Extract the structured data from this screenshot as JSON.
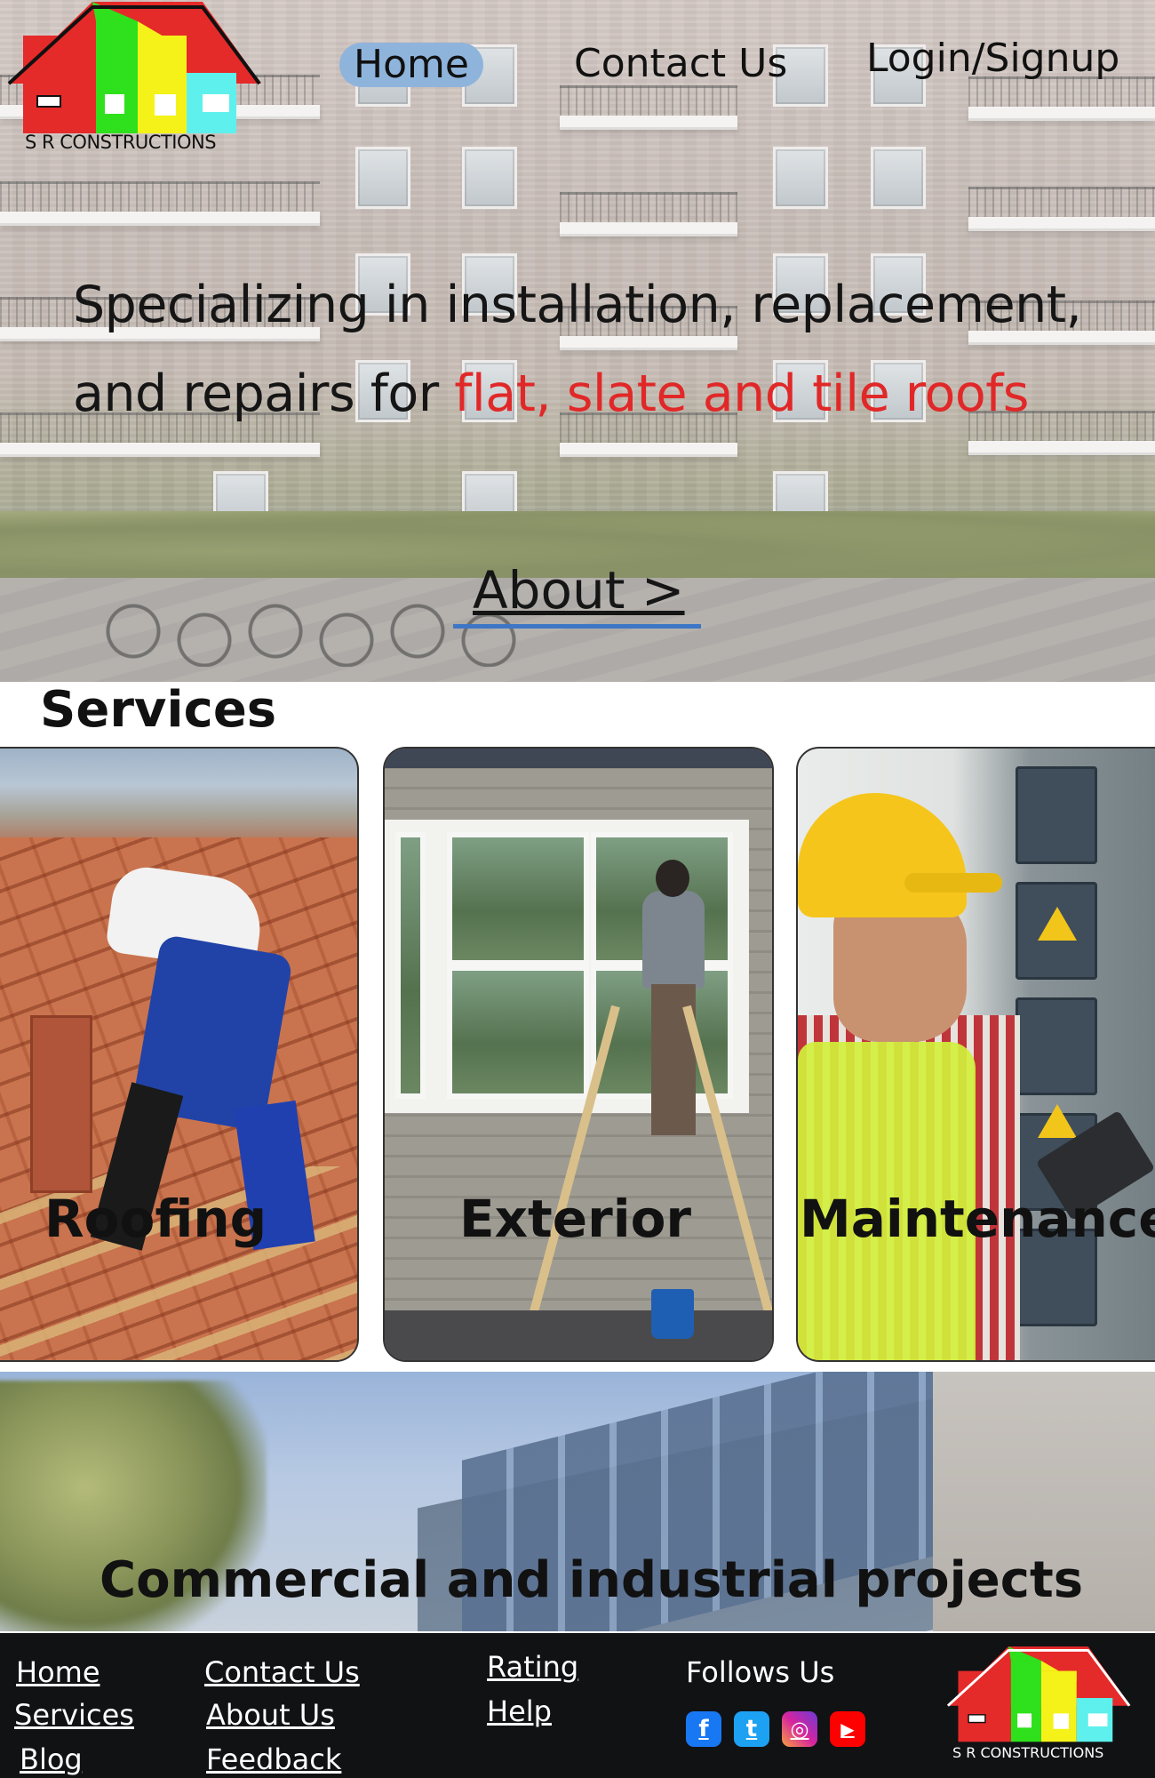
{
  "brand": {
    "name": "S R CONSTRUCTIONS",
    "colors": {
      "red": "#e52a2a",
      "green": "#2fe01c",
      "yellow": "#f5f21a",
      "cyan": "#5ef0ec"
    }
  },
  "nav": {
    "home": "Home",
    "contact": "Contact Us",
    "login": "Login/Signup",
    "active": "Home"
  },
  "hero": {
    "line1": "Specializing in installation, replacement,",
    "line2_prefix": "and repairs for ",
    "line2_highlight": "flat, slate and tile roofs",
    "about_link": "About >"
  },
  "services": {
    "title": "Services",
    "items": [
      {
        "label": "Roofing"
      },
      {
        "label": "Exterior"
      },
      {
        "label": "Maintenance"
      }
    ]
  },
  "projects": {
    "title": "Commercial and industrial projects"
  },
  "footer": {
    "col1": [
      "Home",
      "Services",
      "Blog"
    ],
    "col2": [
      "Contact Us",
      "About Us",
      "Feedback"
    ],
    "col3": [
      "Rating",
      "Help"
    ],
    "follow_title": "Follows Us",
    "social": [
      {
        "icon": "facebook-icon",
        "glyph": "f",
        "color": "#1877f2"
      },
      {
        "icon": "twitter-icon",
        "glyph": "t",
        "color": "#1da1f2"
      },
      {
        "icon": "instagram-icon",
        "glyph": "◎",
        "color": "#d6249f"
      },
      {
        "icon": "youtube-icon",
        "glyph": "▶",
        "color": "#ff0000"
      }
    ],
    "logo_text": "S R CONSTRUCTIONS"
  }
}
